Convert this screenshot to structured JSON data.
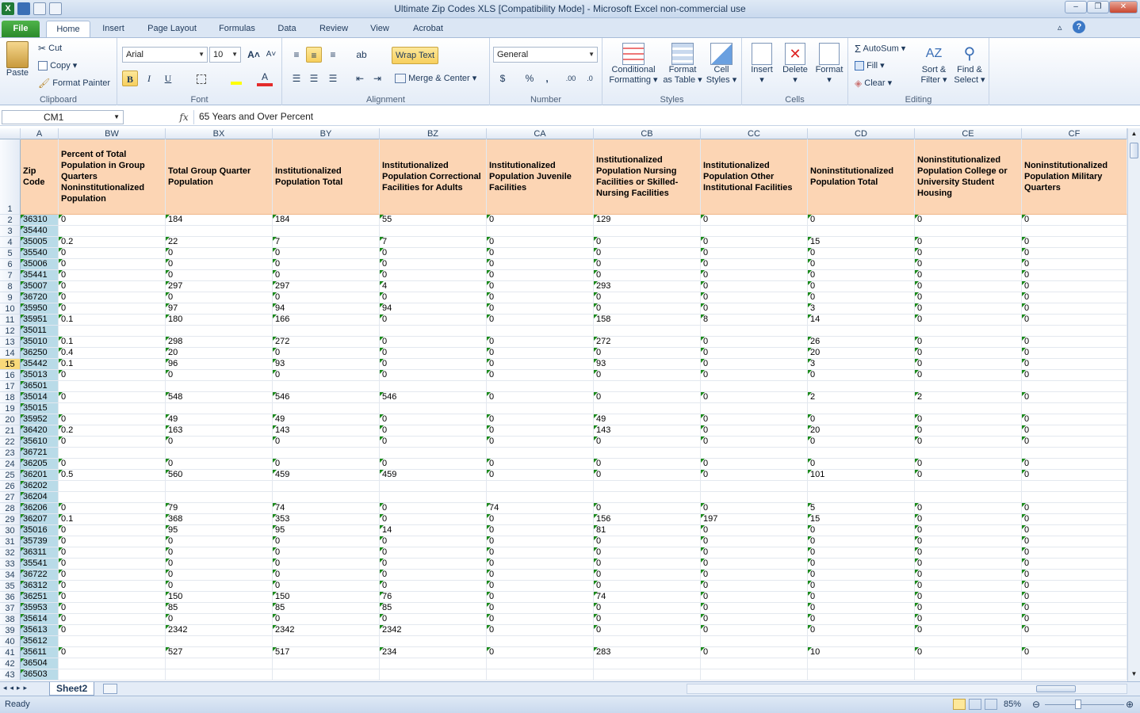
{
  "window": {
    "title": "Ultimate Zip Codes XLS  [Compatibility Mode]  -  Microsoft Excel non-commercial use"
  },
  "ribbon_tabs": [
    "File",
    "Home",
    "Insert",
    "Page Layout",
    "Formulas",
    "Data",
    "Review",
    "View",
    "Acrobat"
  ],
  "clipboard": {
    "paste": "Paste",
    "cut": "Cut",
    "copy": "Copy",
    "format_painter": "Format Painter",
    "label": "Clipboard"
  },
  "font": {
    "name": "Arial",
    "size": "10",
    "bold": "B",
    "italic": "I",
    "underline": "U",
    "label": "Font"
  },
  "alignment": {
    "wrap_text": "Wrap Text",
    "merge_center": "Merge & Center",
    "label": "Alignment"
  },
  "number": {
    "format": "General",
    "currency": "$",
    "percent": "%",
    "comma": ",",
    "label": "Number"
  },
  "styles": {
    "conditional": "Conditional",
    "conditional2": "Formatting",
    "format_as": "Format",
    "format_as2": "as Table",
    "cell": "Cell",
    "cell2": "Styles",
    "label": "Styles"
  },
  "cells_grp": {
    "insert": "Insert",
    "delete": "Delete",
    "format": "Format",
    "label": "Cells"
  },
  "editing": {
    "autosum": "AutoSum",
    "fill": "Fill",
    "clear": "Clear",
    "sort": "Sort &",
    "sort2": "Filter",
    "find": "Find &",
    "find2": "Select",
    "label": "Editing"
  },
  "formula_bar": {
    "name_box": "CM1",
    "fx": "fx",
    "content": "65 Years and Over Percent"
  },
  "columns": [
    {
      "letter": "A",
      "header": "Zip Code"
    },
    {
      "letter": "BW",
      "header": "Percent of Total Population in Group Quarters Noninstitutionalized Population"
    },
    {
      "letter": "BX",
      "header": "Total Group Quarter Population"
    },
    {
      "letter": "BY",
      "header": "Institutionalized Population Total"
    },
    {
      "letter": "BZ",
      "header": "Institutionalized Population Correctional Facilities for Adults"
    },
    {
      "letter": "CA",
      "header": "Institutionalized Population Juvenile Facilities"
    },
    {
      "letter": "CB",
      "header": "Institutionalized Population Nursing Facilities or Skilled-Nursing Facilities"
    },
    {
      "letter": "CC",
      "header": "Institutionalized Population Other Institutional Facilities"
    },
    {
      "letter": "CD",
      "header": "Noninstitutionalized Population Total"
    },
    {
      "letter": "CE",
      "header": "Noninstitutionalized Population College or University Student Housing"
    },
    {
      "letter": "CF",
      "header": "Noninstitutionalized Population Military Quarters"
    }
  ],
  "rows": [
    [
      "36310",
      "0",
      "184",
      "184",
      "55",
      "0",
      "129",
      "0",
      "0",
      "0",
      "0"
    ],
    [
      "35440",
      "",
      "",
      "",
      "",
      "",
      "",
      "",
      "",
      "",
      ""
    ],
    [
      "35005",
      "0.2",
      "22",
      "7",
      "7",
      "0",
      "0",
      "0",
      "15",
      "0",
      "0"
    ],
    [
      "35540",
      "0",
      "0",
      "0",
      "0",
      "0",
      "0",
      "0",
      "0",
      "0",
      "0"
    ],
    [
      "35006",
      "0",
      "0",
      "0",
      "0",
      "0",
      "0",
      "0",
      "0",
      "0",
      "0"
    ],
    [
      "35441",
      "0",
      "0",
      "0",
      "0",
      "0",
      "0",
      "0",
      "0",
      "0",
      "0"
    ],
    [
      "35007",
      "0",
      "297",
      "297",
      "4",
      "0",
      "293",
      "0",
      "0",
      "0",
      "0"
    ],
    [
      "36720",
      "0",
      "0",
      "0",
      "0",
      "0",
      "0",
      "0",
      "0",
      "0",
      "0"
    ],
    [
      "35950",
      "0",
      "97",
      "94",
      "94",
      "0",
      "0",
      "0",
      "3",
      "0",
      "0"
    ],
    [
      "35951",
      "0.1",
      "180",
      "166",
      "0",
      "0",
      "158",
      "8",
      "14",
      "0",
      "0"
    ],
    [
      "35011",
      "",
      "",
      "",
      "",
      "",
      "",
      "",
      "",
      "",
      ""
    ],
    [
      "35010",
      "0.1",
      "298",
      "272",
      "0",
      "0",
      "272",
      "0",
      "26",
      "0",
      "0"
    ],
    [
      "36250",
      "0.4",
      "20",
      "0",
      "0",
      "0",
      "0",
      "0",
      "20",
      "0",
      "0"
    ],
    [
      "35442",
      "0.1",
      "96",
      "93",
      "0",
      "0",
      "93",
      "0",
      "3",
      "0",
      "0"
    ],
    [
      "35013",
      "0",
      "0",
      "0",
      "0",
      "0",
      "0",
      "0",
      "0",
      "0",
      "0"
    ],
    [
      "36501",
      "",
      "",
      "",
      "",
      "",
      "",
      "",
      "",
      "",
      ""
    ],
    [
      "35014",
      "0",
      "548",
      "546",
      "546",
      "0",
      "0",
      "0",
      "2",
      "2",
      "0"
    ],
    [
      "35015",
      "",
      "",
      "",
      "",
      "",
      "",
      "",
      "",
      "",
      ""
    ],
    [
      "35952",
      "0",
      "49",
      "49",
      "0",
      "0",
      "49",
      "0",
      "0",
      "0",
      "0"
    ],
    [
      "36420",
      "0.2",
      "163",
      "143",
      "0",
      "0",
      "143",
      "0",
      "20",
      "0",
      "0"
    ],
    [
      "35610",
      "0",
      "0",
      "0",
      "0",
      "0",
      "0",
      "0",
      "0",
      "0",
      "0"
    ],
    [
      "36721",
      "",
      "",
      "",
      "",
      "",
      "",
      "",
      "",
      "",
      ""
    ],
    [
      "36205",
      "0",
      "0",
      "0",
      "0",
      "0",
      "0",
      "0",
      "0",
      "0",
      "0"
    ],
    [
      "36201",
      "0.5",
      "560",
      "459",
      "459",
      "0",
      "0",
      "0",
      "101",
      "0",
      "0"
    ],
    [
      "36202",
      "",
      "",
      "",
      "",
      "",
      "",
      "",
      "",
      "",
      ""
    ],
    [
      "36204",
      "",
      "",
      "",
      "",
      "",
      "",
      "",
      "",
      "",
      ""
    ],
    [
      "36206",
      "0",
      "79",
      "74",
      "0",
      "74",
      "0",
      "0",
      "5",
      "0",
      "0"
    ],
    [
      "36207",
      "0.1",
      "368",
      "353",
      "0",
      "0",
      "156",
      "197",
      "15",
      "0",
      "0"
    ],
    [
      "35016",
      "0",
      "95",
      "95",
      "14",
      "0",
      "81",
      "0",
      "0",
      "0",
      "0"
    ],
    [
      "35739",
      "0",
      "0",
      "0",
      "0",
      "0",
      "0",
      "0",
      "0",
      "0",
      "0"
    ],
    [
      "36311",
      "0",
      "0",
      "0",
      "0",
      "0",
      "0",
      "0",
      "0",
      "0",
      "0"
    ],
    [
      "35541",
      "0",
      "0",
      "0",
      "0",
      "0",
      "0",
      "0",
      "0",
      "0",
      "0"
    ],
    [
      "36722",
      "0",
      "0",
      "0",
      "0",
      "0",
      "0",
      "0",
      "0",
      "0",
      "0"
    ],
    [
      "36312",
      "0",
      "0",
      "0",
      "0",
      "0",
      "0",
      "0",
      "0",
      "0",
      "0"
    ],
    [
      "36251",
      "0",
      "150",
      "150",
      "76",
      "0",
      "74",
      "0",
      "0",
      "0",
      "0"
    ],
    [
      "35953",
      "0",
      "85",
      "85",
      "85",
      "0",
      "0",
      "0",
      "0",
      "0",
      "0"
    ],
    [
      "35614",
      "0",
      "0",
      "0",
      "0",
      "0",
      "0",
      "0",
      "0",
      "0",
      "0"
    ],
    [
      "35613",
      "0",
      "2342",
      "2342",
      "2342",
      "0",
      "0",
      "0",
      "0",
      "0",
      "0"
    ],
    [
      "35612",
      "",
      "",
      "",
      "",
      "",
      "",
      "",
      "",
      "",
      ""
    ],
    [
      "35611",
      "0",
      "527",
      "517",
      "234",
      "0",
      "283",
      "0",
      "10",
      "0",
      "0"
    ],
    [
      "36504",
      "",
      "",
      "",
      "",
      "",
      "",
      "",
      "",
      "",
      ""
    ],
    [
      "36503",
      "",
      "",
      "",
      "",
      "",
      "",
      "",
      "",
      "",
      ""
    ]
  ],
  "highlight_row": 15,
  "sheet_tab": "Sheet2",
  "status": {
    "ready": "Ready",
    "zoom": "85%"
  },
  "colors": {
    "header_fill": "#fcd5b4",
    "zip_fill": "#b9dbe8",
    "accent": "#2b8a2b"
  }
}
